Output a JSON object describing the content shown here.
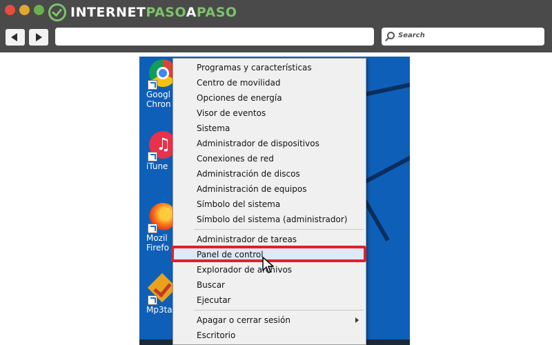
{
  "browser": {
    "logo": {
      "part1": "INTERNET",
      "part2": "PASO",
      "part3": "A",
      "part4": "PASO"
    },
    "search_label": "Search"
  },
  "desktop": {
    "icons": [
      {
        "name": "chrome",
        "label_line1": "Googl",
        "label_line2": "Chron"
      },
      {
        "name": "itunes",
        "label_line1": "iTune",
        "label_line2": ""
      },
      {
        "name": "firefox",
        "label_line1": "Mozil",
        "label_line2": "Firefo"
      },
      {
        "name": "mp3",
        "label_line1": "Mp3ta",
        "label_line2": ""
      }
    ]
  },
  "menu": {
    "items": [
      {
        "label": "Programas y características"
      },
      {
        "label": "Centro de movilidad"
      },
      {
        "label": "Opciones de energía"
      },
      {
        "label": "Visor de eventos"
      },
      {
        "label": "Sistema"
      },
      {
        "label": "Administrador de dispositivos"
      },
      {
        "label": "Conexiones de red"
      },
      {
        "label": "Administración de discos"
      },
      {
        "label": "Administración de equipos"
      },
      {
        "label": "Símbolo del sistema"
      },
      {
        "label": "Símbolo del sistema (administrador)"
      },
      {
        "label": "Administrador de tareas"
      },
      {
        "label": "Panel de control"
      },
      {
        "label": "Explorador de archivos"
      },
      {
        "label": "Buscar"
      },
      {
        "label": "Ejecutar"
      },
      {
        "label": "Apagar o cerrar sesión"
      },
      {
        "label": "Escritorio"
      }
    ],
    "highlighted_item": "Panel de control"
  },
  "colors": {
    "highlight_border": "#e0202a",
    "desktop_bg": "#0e5fb8",
    "chrome_bg": "#4a4a4a"
  }
}
